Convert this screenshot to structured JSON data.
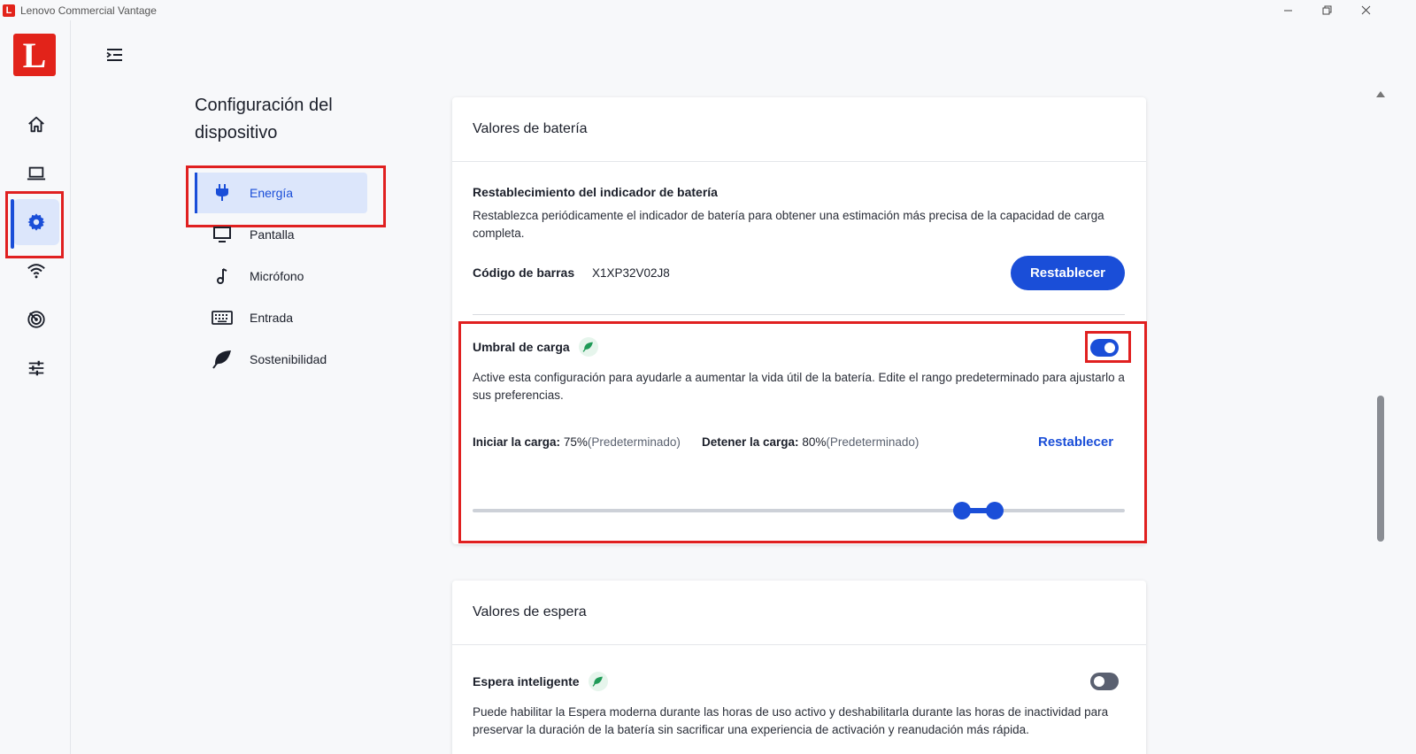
{
  "window": {
    "title": "Lenovo Commercial Vantage",
    "app_icon": "L"
  },
  "rail": {
    "logo": "L",
    "items": [
      {
        "icon": "home-icon"
      },
      {
        "icon": "laptop-icon"
      },
      {
        "icon": "gear-icon",
        "active": true
      },
      {
        "icon": "wifi-icon"
      },
      {
        "icon": "radar-icon"
      },
      {
        "icon": "sliders-icon"
      }
    ]
  },
  "section": {
    "title": "Configuración del dispositivo"
  },
  "subnav": {
    "items": [
      {
        "label": "Energía",
        "icon": "plug-icon",
        "active": true
      },
      {
        "label": "Pantalla",
        "icon": "monitor-icon"
      },
      {
        "label": "Micrófono",
        "icon": "music-note-icon"
      },
      {
        "label": "Entrada",
        "icon": "keyboard-icon"
      },
      {
        "label": "Sostenibilidad",
        "icon": "leaf-icon"
      }
    ]
  },
  "battery": {
    "title": "Valores de batería",
    "reset_indicator": {
      "title": "Restablecimiento del indicador de batería",
      "description": "Restablezca periódicamente el indicador de batería para obtener una estimación más precisa de la capacidad de carga completa.",
      "barcode_label": "Código de barras",
      "barcode_value": "X1XP32V02J8",
      "button": "Restablecer"
    },
    "threshold": {
      "title": "Umbral de carga",
      "enabled": true,
      "description": "Active esta configuración para ayudarle a aumentar la vida útil de la batería. Edite el rango predeterminado para ajustarlo a sus preferencias.",
      "start_label": "Iniciar la carga:",
      "start_value": "75%",
      "start_note": "(Predeterminado)",
      "stop_label": "Detener la carga:",
      "stop_value": "80%",
      "stop_note": "(Predeterminado)",
      "reset_button": "Restablecer",
      "slider_start_fraction": 0.75,
      "slider_stop_fraction": 0.8
    }
  },
  "standby": {
    "title": "Valores de espera",
    "smart": {
      "title": "Espera inteligente",
      "enabled": false,
      "description": "Puede habilitar la Espera moderna durante las horas de uso activo y deshabilitarla durante las horas de inactividad para preservar la duración de la batería sin sacrificar una experiencia de activación y reanudación más rápida."
    }
  },
  "colors": {
    "accent": "#1a4ed8",
    "brand": "#e2231a",
    "highlight": "#e02020"
  }
}
